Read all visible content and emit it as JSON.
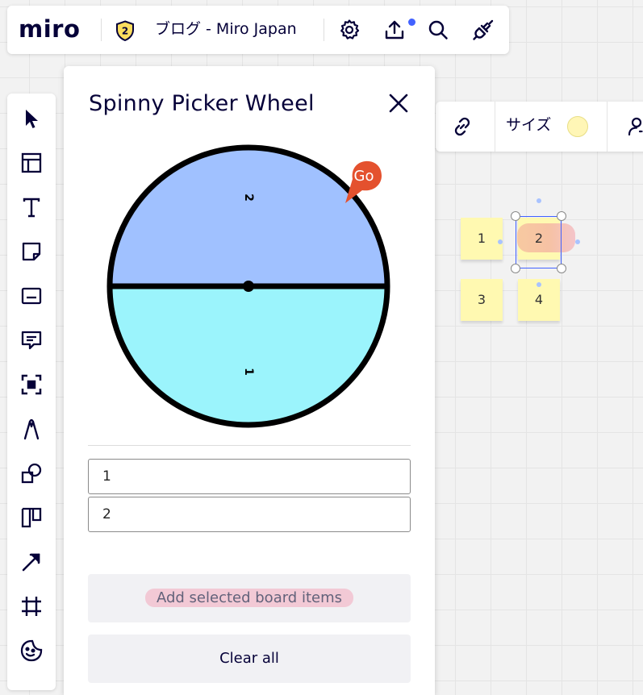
{
  "topbar": {
    "logo": "miro",
    "plan_badge": "2",
    "board_name": "ブログ - Miro Japan",
    "icons": [
      "settings-icon",
      "upload-icon",
      "search-icon",
      "plug-icon"
    ],
    "accent_color": "#4262ff"
  },
  "left_toolbar": {
    "tools": [
      "select-icon",
      "templates-icon",
      "text-icon",
      "sticky-note-icon",
      "card-icon",
      "comment-icon",
      "frame-select-icon",
      "pen-icon",
      "shapes-icon",
      "kanban-icon",
      "arrow-icon",
      "frame-icon",
      "emoji-icon"
    ]
  },
  "context_toolbar": {
    "size_label": "サイズ",
    "swatch_color": "#fff6b6",
    "icons": [
      "link-icon",
      "user-icon"
    ]
  },
  "panel": {
    "title": "Spinny Picker Wheel",
    "go_label": "Go",
    "wheel": {
      "segments": [
        {
          "label": "2",
          "color": "#a0c1ff"
        },
        {
          "label": "1",
          "color": "#9bf4fc"
        }
      ],
      "go_color": "#e4512e"
    },
    "entries": [
      {
        "value": "1"
      },
      {
        "value": "2"
      }
    ],
    "add_button": "Add selected board items",
    "clear_button": "Clear all"
  },
  "board": {
    "sticky_color": "#fff9b1",
    "stickies": [
      {
        "label": "1"
      },
      {
        "label": "2"
      },
      {
        "label": "3"
      },
      {
        "label": "4"
      }
    ]
  }
}
